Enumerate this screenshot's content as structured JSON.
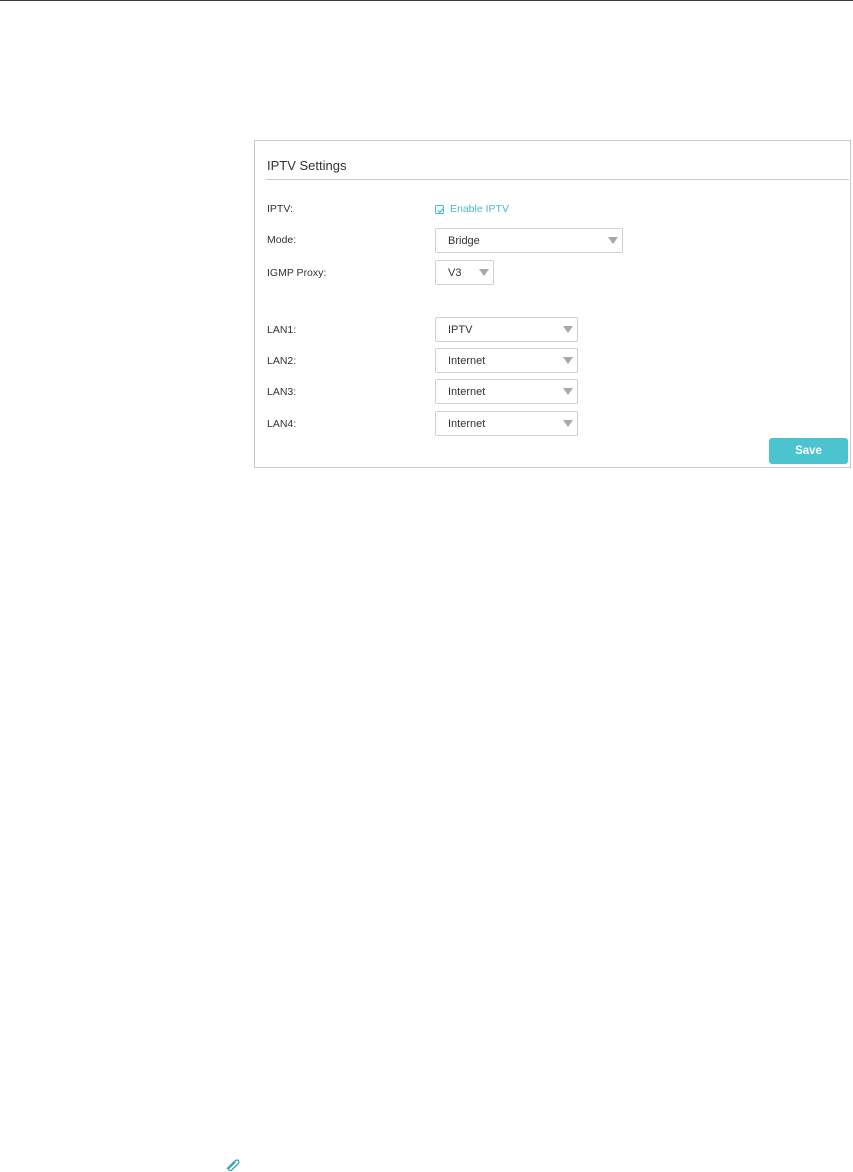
{
  "panel": {
    "title": "IPTV Settings",
    "iptv_label": "IPTV:",
    "enable_iptv_label": "Enable IPTV",
    "enable_iptv_checked": true,
    "mode_label": "Mode:",
    "mode_value": "Bridge",
    "igmp_label": "IGMP Proxy:",
    "igmp_value": "V3",
    "lans": [
      {
        "label": "LAN1:",
        "value": "IPTV"
      },
      {
        "label": "LAN2:",
        "value": "Internet"
      },
      {
        "label": "LAN3:",
        "value": "Internet"
      },
      {
        "label": "LAN4:",
        "value": "Internet"
      }
    ],
    "save_label": "Save"
  },
  "icons": {
    "checkbox": "checkmark-icon",
    "dropdown": "chevron-down-icon",
    "footer": "paperclip-icon"
  },
  "colors": {
    "accent": "#4bc4cf",
    "accent_text": "#4bb9c9",
    "border": "#c9c9c9"
  }
}
